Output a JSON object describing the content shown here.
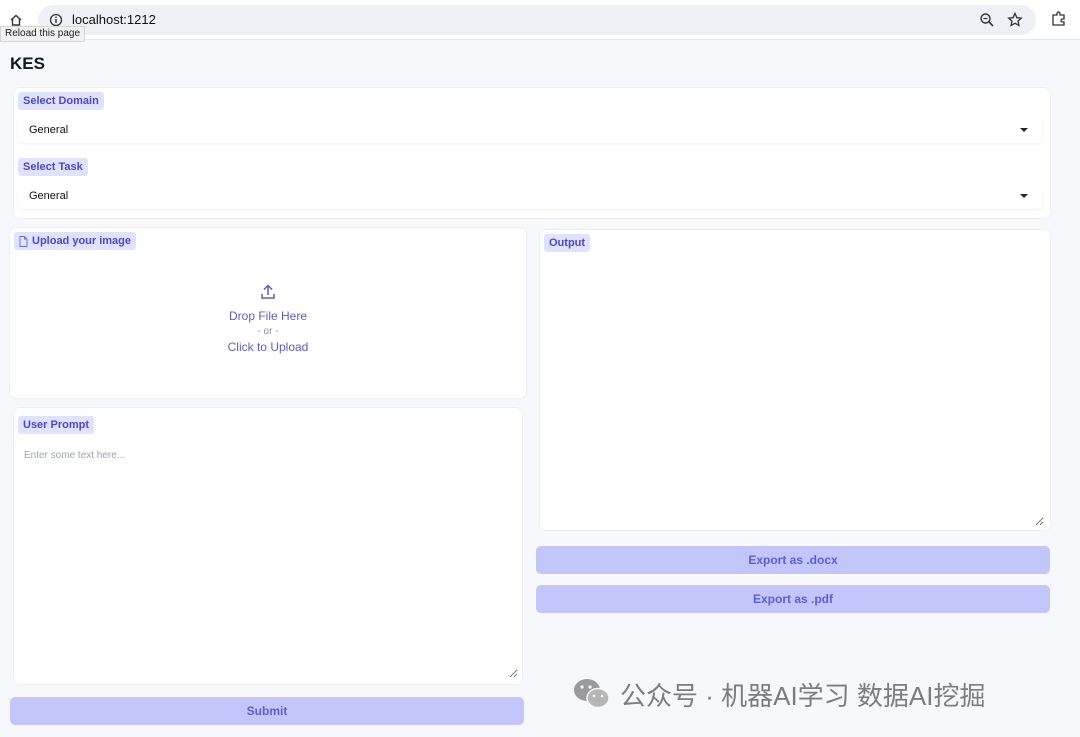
{
  "browser": {
    "url": "localhost:1212",
    "tooltip": "Reload this page"
  },
  "app": {
    "title": "KES"
  },
  "domain": {
    "label": "Select Domain",
    "value": "General"
  },
  "task": {
    "label": "Select Task",
    "value": "General"
  },
  "upload": {
    "label": "Upload your image",
    "drop": "Drop File Here",
    "or": "- or -",
    "click": "Click to Upload"
  },
  "prompt": {
    "label": "User Prompt",
    "placeholder": "Enter some text here..."
  },
  "output": {
    "label": "Output",
    "value": ""
  },
  "buttons": {
    "submit": "Submit",
    "export_docx": "Export as .docx",
    "export_pdf": "Export as .pdf"
  },
  "watermark": {
    "text": "公众号 · 机器AI学习 数据AI挖掘"
  },
  "colors": {
    "accent": "#5b5fd6",
    "chip_bg": "#e0e3ff",
    "button_bg": "#c3c6fb"
  }
}
